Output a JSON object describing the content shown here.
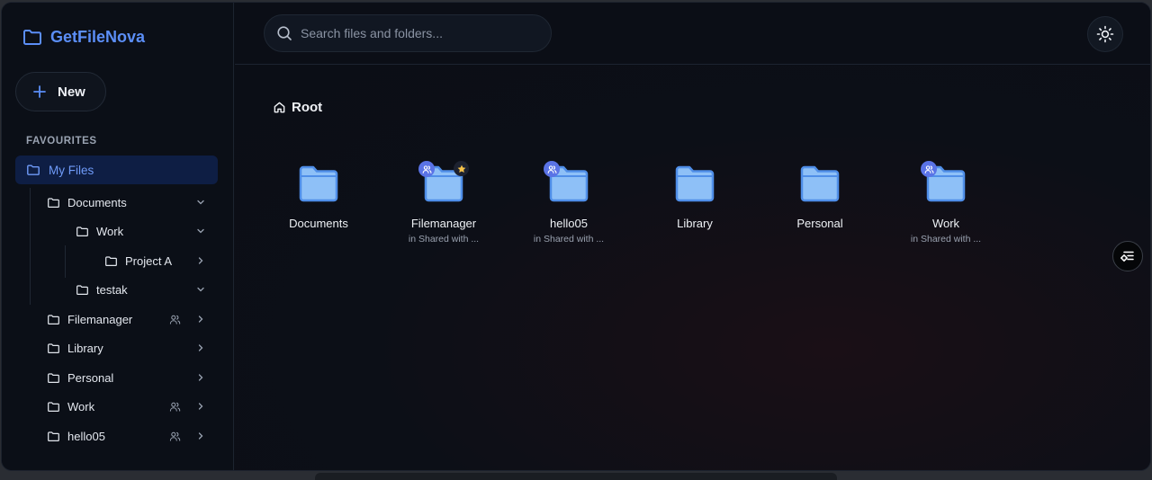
{
  "brand": {
    "name": "GetFileNova"
  },
  "sidebar": {
    "new_label": "New",
    "section_title": "FAVOURITES",
    "my_files_label": "My Files",
    "tree": [
      {
        "label": "Documents"
      },
      {
        "label": "Work"
      },
      {
        "label": "Project A"
      },
      {
        "label": "testak"
      },
      {
        "label": "Filemanager"
      },
      {
        "label": "Library"
      },
      {
        "label": "Personal"
      },
      {
        "label": "Work"
      },
      {
        "label": "hello05"
      }
    ]
  },
  "search": {
    "placeholder": "Search files and folders..."
  },
  "breadcrumb": {
    "label": "Root"
  },
  "folders": [
    {
      "name": "Documents",
      "sub": ""
    },
    {
      "name": "Filemanager",
      "sub": "in Shared with ..."
    },
    {
      "name": "hello05",
      "sub": "in Shared with ..."
    },
    {
      "name": "Library",
      "sub": ""
    },
    {
      "name": "Personal",
      "sub": ""
    },
    {
      "name": "Work",
      "sub": "in Shared with ..."
    }
  ],
  "colors": {
    "accent": "#5b8ef7",
    "selected_bg": "#0e1e44",
    "folder_fill": "#8ec0f7",
    "share_badge": "#5a73e6",
    "star": "#f5c24a"
  },
  "icons": {
    "brand": "folder-icon",
    "new": "plus-icon",
    "search": "search-icon",
    "theme": "sun-icon",
    "float": "settings-list-icon"
  }
}
